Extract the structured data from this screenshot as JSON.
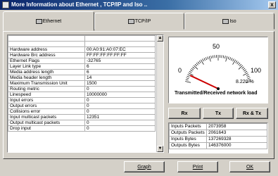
{
  "window": {
    "title": "More Information about Ethernet , TCP/IP and Iso ..",
    "close_label": "x"
  },
  "tabs": [
    {
      "label": "Ethernet",
      "active": true
    },
    {
      "label": "TCP/IP",
      "active": false
    },
    {
      "label": "Iso",
      "active": false
    }
  ],
  "properties": [
    {
      "name": "Hardware address",
      "value": "00:A0:91:A0:07:EC"
    },
    {
      "name": "Hardware Brc address",
      "value": "FF:FF:FF:FF:FF:FF"
    },
    {
      "name": "Ethernet Flags",
      "value": "-32765"
    },
    {
      "name": "Layer Link type",
      "value": "6"
    },
    {
      "name": "Media address length",
      "value": "6"
    },
    {
      "name": "Media header length",
      "value": "14"
    },
    {
      "name": "Maximum Transmission Unit",
      "value": "1500"
    },
    {
      "name": "Routing metric",
      "value": "0"
    },
    {
      "name": "Linespeed",
      "value": "10000000"
    },
    {
      "name": "Input errors",
      "value": "0"
    },
    {
      "name": "Output errors",
      "value": "0"
    },
    {
      "name": "Collisions error",
      "value": "0"
    },
    {
      "name": "Input multicast packets",
      "value": "12351"
    },
    {
      "name": "Output multicast packets",
      "value": "0"
    },
    {
      "name": "Drop input",
      "value": "0"
    }
  ],
  "gauge": {
    "tick_labels": [
      "0",
      "50",
      "100"
    ],
    "percent_text": "8.220 %",
    "value_fraction": 0.0822,
    "label": "Transmitted/Received network load",
    "needle_color": "#cc0000"
  },
  "mode_buttons": {
    "rx": "Rx",
    "tx": "Tx",
    "rxtx": "Rx & Tx"
  },
  "stats": [
    {
      "name": "Inputs Packets",
      "value": "2073958"
    },
    {
      "name": "Outputs Packets",
      "value": "2061643"
    },
    {
      "name": "Inputs Bytes",
      "value": "137269328"
    },
    {
      "name": "Outputs Bytes",
      "value": "146376000"
    }
  ],
  "footer": {
    "graph": "Graph",
    "print": "Print",
    "ok": "OK"
  }
}
